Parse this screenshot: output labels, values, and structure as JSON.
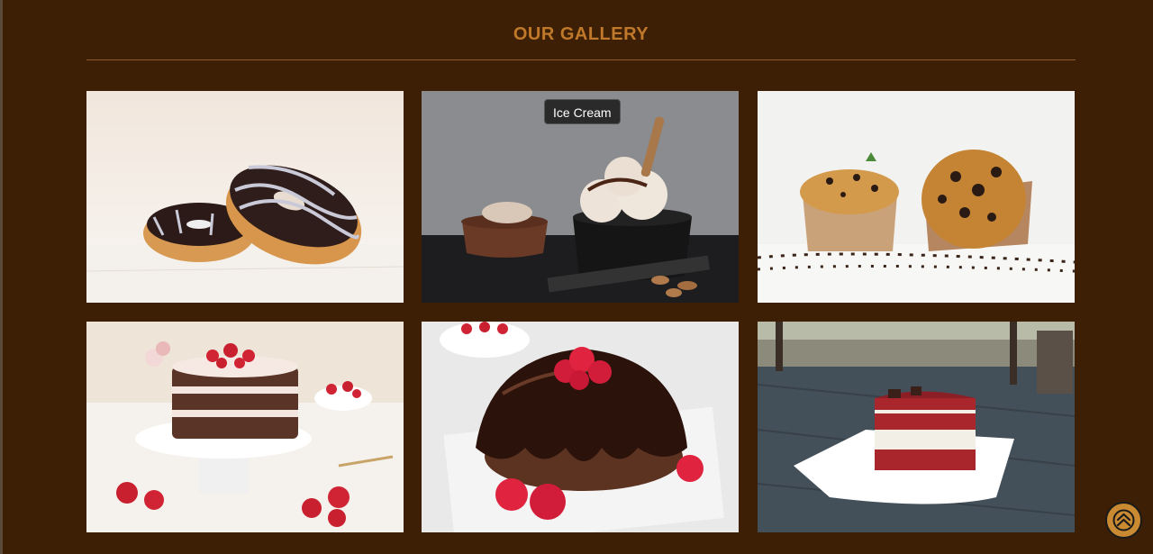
{
  "gallery": {
    "title": "OUR GALLERY",
    "items": [
      {
        "subject": "chocolate glazed donuts",
        "icon": "donut-image"
      },
      {
        "subject": "ice cream",
        "icon": "ice-cream-image",
        "tooltip": "Ice Cream"
      },
      {
        "subject": "chocolate chip muffins",
        "icon": "muffin-image"
      },
      {
        "subject": "strawberry layer cake",
        "icon": "strawberry-cake-image"
      },
      {
        "subject": "chocolate bundt cake with raspberries",
        "icon": "bundt-cake-image"
      },
      {
        "subject": "red velvet cake slice",
        "icon": "red-velvet-image"
      }
    ]
  },
  "back_to_top": {
    "icon": "chevron-up-icon"
  },
  "colors": {
    "background": "#3c1f04",
    "accent": "#c0782a",
    "button": "#c98a32"
  }
}
